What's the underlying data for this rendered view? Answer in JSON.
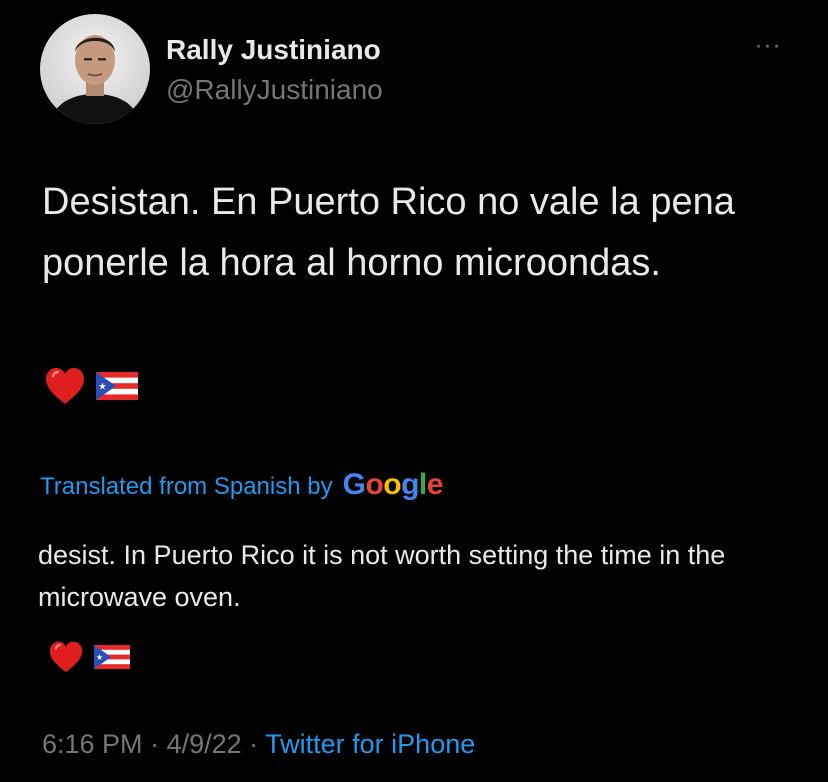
{
  "author": {
    "display_name": "Rally Justiniano",
    "handle": "@RallyJustiniano"
  },
  "menu": {
    "more_label": "···"
  },
  "tweet": {
    "text": "Desistan. En Puerto Rico no vale la pena ponerle la hora al horno microondas.",
    "emojis": [
      "heart-emoji",
      "puerto-rico-flag-emoji"
    ]
  },
  "translation": {
    "label": "Translated from Spanish by",
    "provider": "Google",
    "text": "desist. In Puerto Rico it is not worth setting the time in the microwave oven.",
    "emojis": [
      "heart-emoji",
      "puerto-rico-flag-emoji"
    ]
  },
  "meta": {
    "time": "6:16 PM",
    "separator": " · ",
    "date": "4/9/22",
    "source": "Twitter for iPhone"
  },
  "colors": {
    "background": "#000000",
    "text_primary": "#e7e9ea",
    "text_secondary": "#71767b",
    "link": "#1d9bf0",
    "google_blue": "#4285f4",
    "google_red": "#ea4335",
    "google_yellow": "#fbbc05",
    "google_green": "#34a853"
  }
}
